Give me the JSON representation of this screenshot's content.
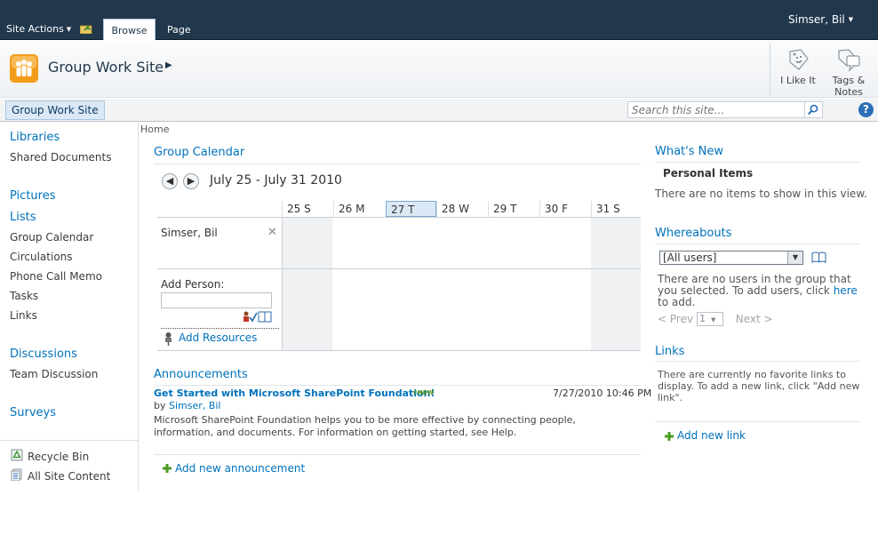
{
  "ribbon": {
    "site_actions": "Site Actions",
    "tabs": [
      {
        "label": "Browse"
      },
      {
        "label": "Page"
      }
    ],
    "user": "Simser, Bil"
  },
  "title_area": {
    "site_title": "Group Work Site",
    "like": "I Like It",
    "tags": "Tags &",
    "notes": "Notes"
  },
  "topnav": {
    "home": "Group Work Site",
    "search_placeholder": "Search this site..."
  },
  "quick_launch": {
    "libraries": "Libraries",
    "shared_documents": "Shared Documents",
    "pictures": "Pictures",
    "lists": "Lists",
    "list_items": [
      "Group Calendar",
      "Circulations",
      "Phone Call Memo",
      "Tasks",
      "Links"
    ],
    "discussions": "Discussions",
    "team_discussion": "Team Discussion",
    "surveys": "Surveys",
    "recycle_bin": "Recycle Bin",
    "all_site_content": "All Site Content"
  },
  "breadcrumb": "Home",
  "calendar": {
    "title": "Group Calendar",
    "range": "July 25 - July 31 2010",
    "days": [
      "25 S",
      "26 M",
      "27 T",
      "28 W",
      "29 T",
      "30 F",
      "31 S"
    ],
    "today_index": 2,
    "person": "Simser, Bil",
    "add_person_label": "Add Person:",
    "add_resources": "Add Resources"
  },
  "announcements": {
    "title": "Announcements",
    "item_title": "Get Started with Microsoft SharePoint Foundation!",
    "new_badge": "NEW",
    "date": "7/27/2010 10:46 PM",
    "by_prefix": "by",
    "author": "Simser, Bil",
    "body": "Microsoft SharePoint Foundation helps you to be more effective by connecting people, information, and documents. For information on getting started, see Help.",
    "add_new": "Add new announcement"
  },
  "whats_new": {
    "title": "What's New",
    "subtitle": "Personal Items",
    "message": "There are no items to show in this view."
  },
  "whereabouts": {
    "title": "Whereabouts",
    "selected": "[All users]",
    "message_before_link": "There are no users in the group that you selected. To add users, click",
    "link": "here",
    "message_after_link": "to add.",
    "prev": "< Prev",
    "page": "1",
    "next": "Next >"
  },
  "links": {
    "title": "Links",
    "message": "There are currently no favorite links to display. To add a new link, click \"Add new link\".",
    "add_new": "Add new link"
  },
  "colors": {
    "ribbon": "#21374c",
    "link": "#0072bc",
    "weekend": "#f0f1f2"
  }
}
